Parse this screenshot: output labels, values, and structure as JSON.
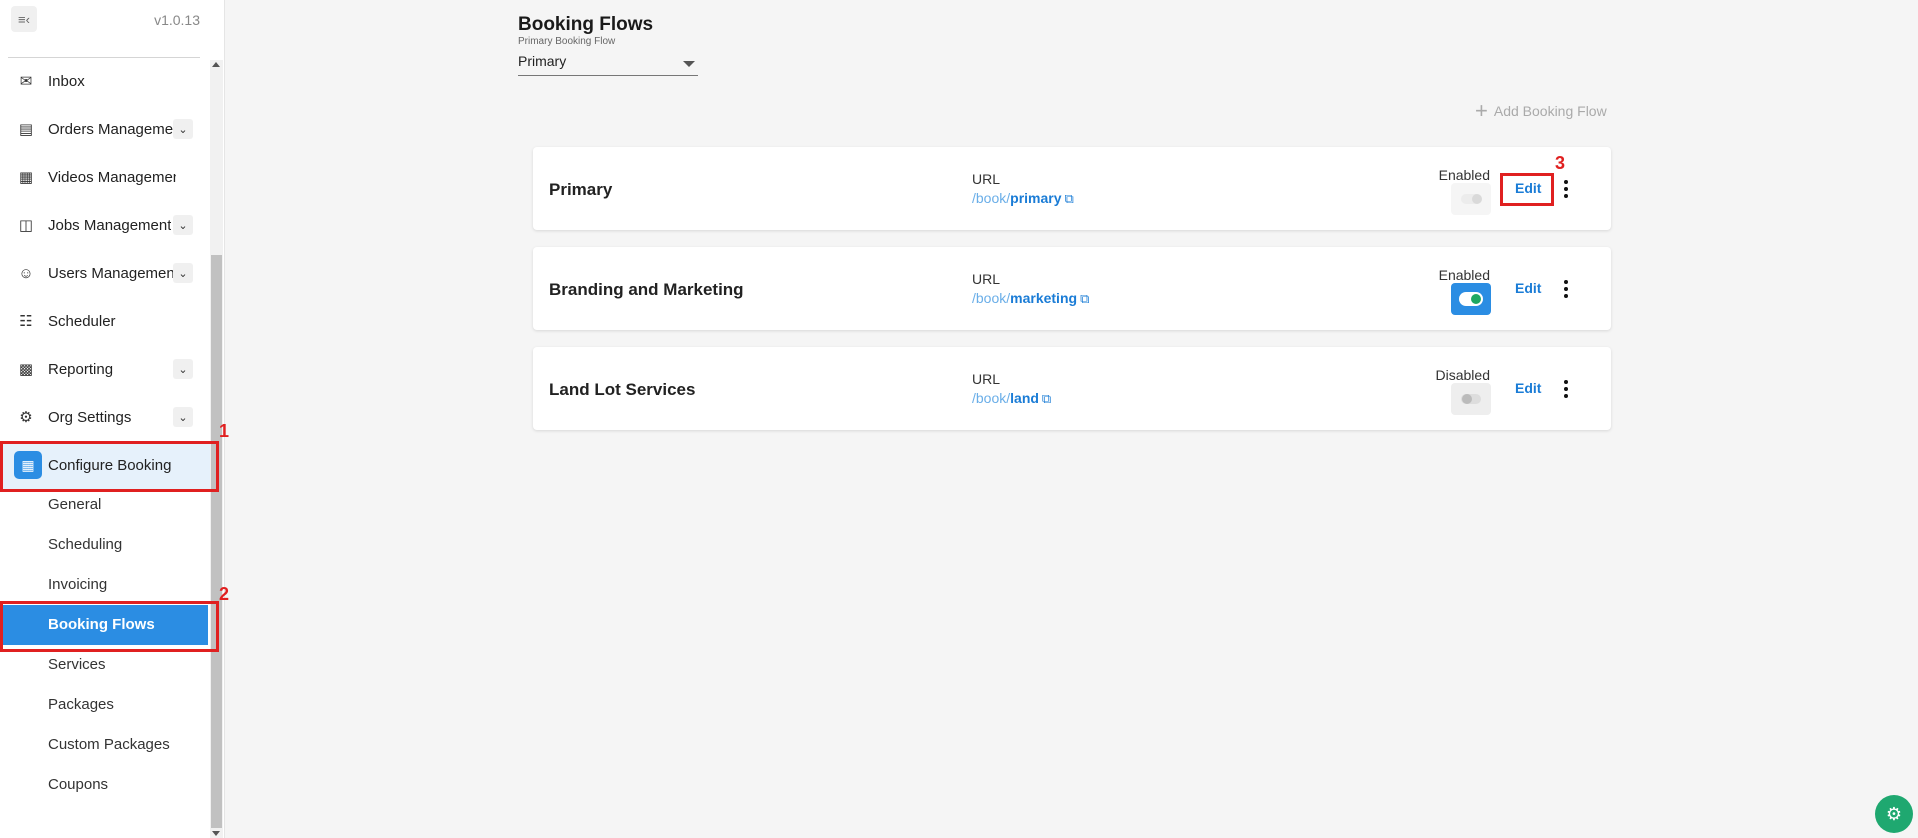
{
  "app": {
    "version": "v1.0.13",
    "collapse_icon": "collapse-sidebar-icon"
  },
  "sidebar": {
    "items": [
      {
        "label": "Inbox",
        "icon": "mail-icon",
        "expandable": false
      },
      {
        "label": "Orders Management",
        "icon": "orders-icon",
        "expandable": true
      },
      {
        "label": "Videos Management",
        "icon": "videos-icon",
        "expandable": false
      },
      {
        "label": "Jobs Management",
        "icon": "jobs-icon",
        "expandable": true
      },
      {
        "label": "Users Management",
        "icon": "users-icon",
        "expandable": true
      },
      {
        "label": "Scheduler",
        "icon": "scheduler-icon",
        "expandable": false
      },
      {
        "label": "Reporting",
        "icon": "reporting-icon",
        "expandable": true
      },
      {
        "label": "Org Settings",
        "icon": "gear-icon",
        "expandable": true
      },
      {
        "label": "Configure Booking",
        "icon": "booking-icon",
        "expandable": false,
        "active": true
      }
    ],
    "subitems": [
      {
        "label": "General"
      },
      {
        "label": "Scheduling"
      },
      {
        "label": "Invoicing"
      },
      {
        "label": "Booking Flows",
        "active": true
      },
      {
        "label": "Services"
      },
      {
        "label": "Packages"
      },
      {
        "label": "Custom Packages"
      },
      {
        "label": "Coupons"
      }
    ]
  },
  "annotations": {
    "n1": "1",
    "n2": "2",
    "n3": "3",
    "color": "#e02020"
  },
  "main": {
    "title": "Booking Flows",
    "select": {
      "label": "Primary Booking Flow",
      "value": "Primary"
    },
    "add_button": "Add Booking Flow",
    "flows": [
      {
        "name": "Primary",
        "url_label": "URL",
        "url_prefix": "/book/",
        "url_slug": "primary",
        "status": "Enabled",
        "toggle": "on-disabled",
        "edit": "Edit"
      },
      {
        "name": "Branding and Marketing",
        "url_label": "URL",
        "url_prefix": "/book/",
        "url_slug": "marketing",
        "status": "Enabled",
        "toggle": "on",
        "edit": "Edit"
      },
      {
        "name": "Land Lot Services",
        "url_label": "URL",
        "url_prefix": "/book/",
        "url_slug": "land",
        "status": "Disabled",
        "toggle": "off",
        "edit": "Edit"
      }
    ]
  },
  "colors": {
    "accent": "#2b8de3",
    "link": "#1a7cd6",
    "success": "#1fa862",
    "fab": "#1fa870"
  }
}
